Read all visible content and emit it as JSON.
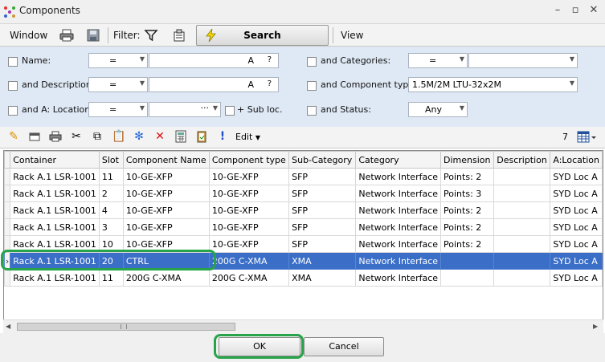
{
  "window": {
    "title": "Components",
    "count": "7"
  },
  "toolbar": {
    "window_label": "Window",
    "filter_label": "Filter:",
    "search_label": "Search",
    "view_label": "View"
  },
  "filters": {
    "name": {
      "label": "Name:",
      "op": "=",
      "a": "A",
      "q": "?"
    },
    "description": {
      "label": "and Description:",
      "op": "=",
      "a": "A",
      "q": "?"
    },
    "location": {
      "label": "and A: Location:",
      "op": "=",
      "dots": "···",
      "sublabel": "+ Sub loc."
    },
    "categories": {
      "label": "and Categories:",
      "op": "="
    },
    "component_type": {
      "label": "and Component type:",
      "value": "1.5M/2M LTU-32x2M"
    },
    "status": {
      "label": "and Status:",
      "value": "Any"
    }
  },
  "actions": {
    "edit_label": "Edit"
  },
  "grid": {
    "columns": [
      "Container",
      "Slot",
      "Component Name",
      "Component type",
      "Sub-Category",
      "Category",
      "Dimension",
      "Description",
      "A:Location"
    ],
    "rows": [
      [
        "Rack A.1 LSR-1001",
        "11",
        "10-GE-XFP",
        "10-GE-XFP",
        "SFP",
        "Network Interface",
        "Points: 2",
        "",
        "SYD Loc A"
      ],
      [
        "Rack A.1 LSR-1001",
        "2",
        "10-GE-XFP",
        "10-GE-XFP",
        "SFP",
        "Network Interface",
        "Points: 3",
        "",
        "SYD Loc A"
      ],
      [
        "Rack A.1 LSR-1001",
        "4",
        "10-GE-XFP",
        "10-GE-XFP",
        "SFP",
        "Network Interface",
        "Points: 2",
        "",
        "SYD Loc A"
      ],
      [
        "Rack A.1 LSR-1001",
        "3",
        "10-GE-XFP",
        "10-GE-XFP",
        "SFP",
        "Network Interface",
        "Points: 2",
        "",
        "SYD Loc A"
      ],
      [
        "Rack A.1 LSR-1001",
        "10",
        "10-GE-XFP",
        "10-GE-XFP",
        "SFP",
        "Network Interface",
        "Points: 2",
        "",
        "SYD Loc A"
      ],
      [
        "Rack A.1 LSR-1001",
        "20",
        "CTRL",
        "200G C-XMA",
        "XMA",
        "Network Interface",
        "",
        "",
        "SYD Loc A"
      ],
      [
        "Rack A.1 LSR-1001",
        "11",
        "200G C-XMA",
        "200G C-XMA",
        "XMA",
        "Network Interface",
        "",
        "",
        "SYD Loc A"
      ]
    ],
    "selected_row": 5
  },
  "footer": {
    "ok_label": "OK",
    "cancel_label": "Cancel"
  },
  "colors": {
    "selection": "#3a6ec7",
    "highlight": "#27a44a",
    "filter_panel": "#dfe9f5"
  }
}
